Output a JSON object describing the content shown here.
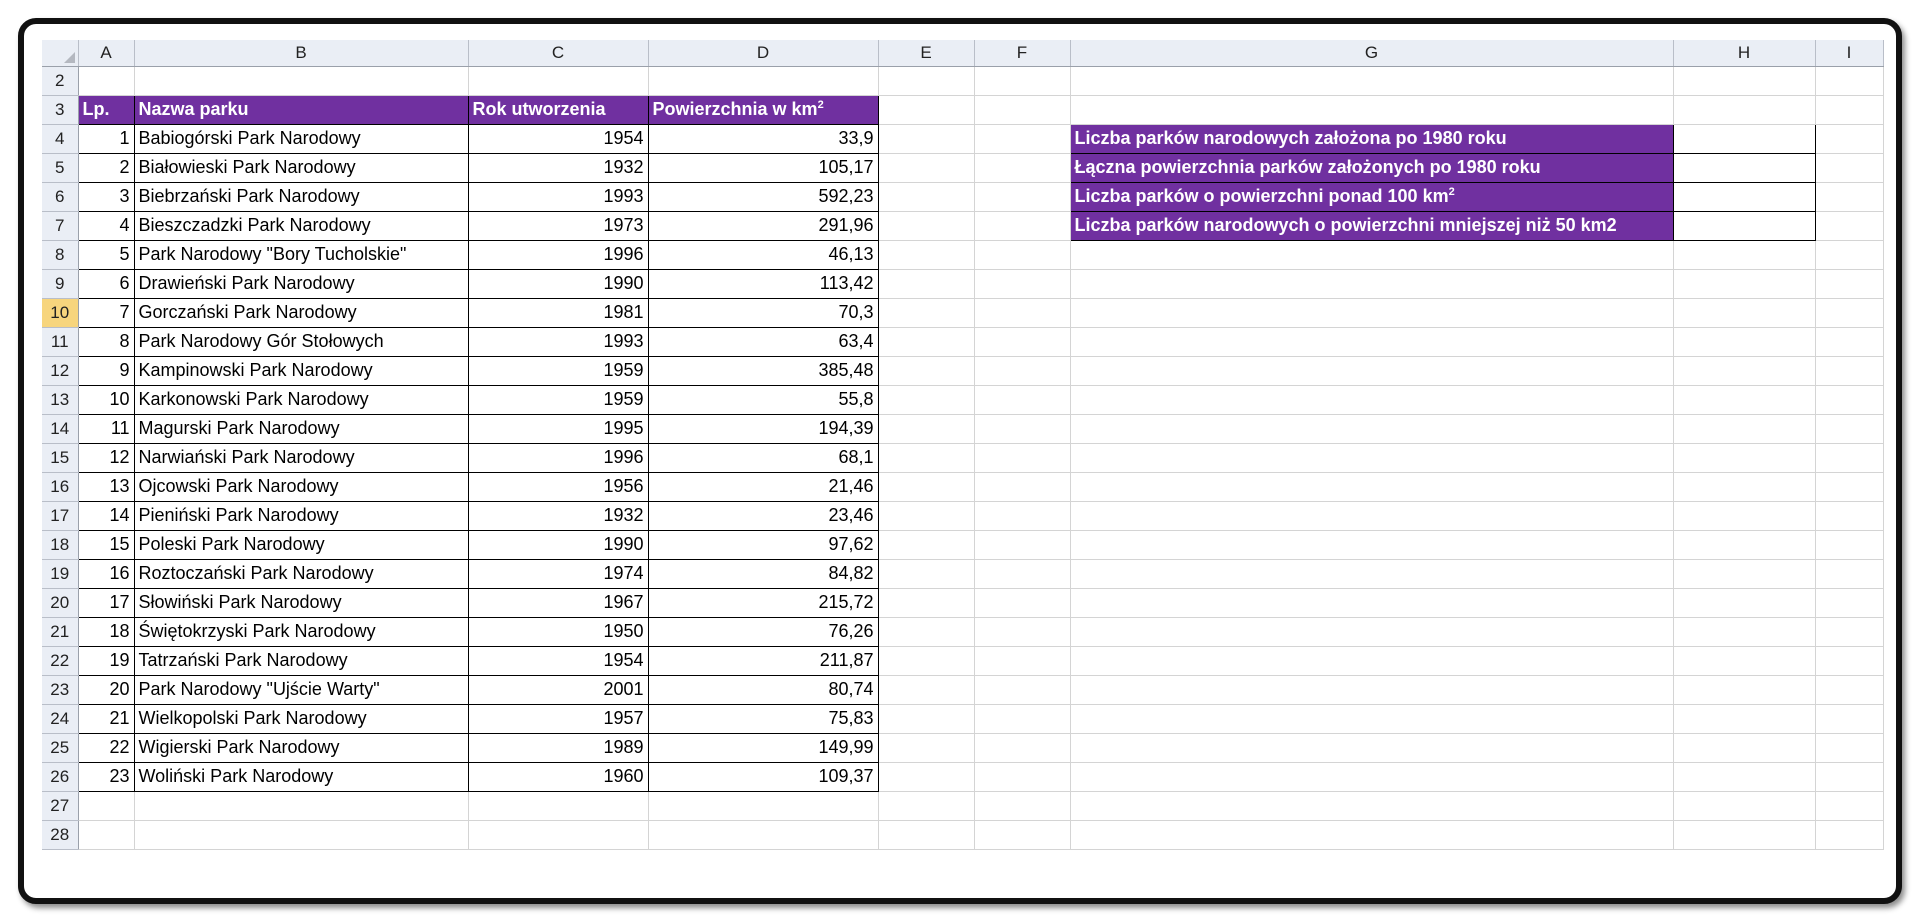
{
  "columns": [
    "A",
    "B",
    "C",
    "D",
    "E",
    "F",
    "G",
    "H",
    "I"
  ],
  "active_row": "10",
  "header_row": {
    "row": "3",
    "lp": "Lp.",
    "name": "Nazwa parku",
    "year": "Rok utworzenia",
    "area": "Powierzchnia w km",
    "area_sup": "2"
  },
  "rows": [
    {
      "row": "4",
      "lp": "1",
      "name": "Babiogórski Park Narodowy",
      "year": "1954",
      "area": "33,9"
    },
    {
      "row": "5",
      "lp": "2",
      "name": "Białowieski Park Narodowy",
      "year": "1932",
      "area": "105,17"
    },
    {
      "row": "6",
      "lp": "3",
      "name": "Biebrzański Park Narodowy",
      "year": "1993",
      "area": "592,23"
    },
    {
      "row": "7",
      "lp": "4",
      "name": "Bieszczadzki Park Narodowy",
      "year": "1973",
      "area": "291,96"
    },
    {
      "row": "8",
      "lp": "5",
      "name": "Park Narodowy \"Bory Tucholskie\"",
      "year": "1996",
      "area": "46,13"
    },
    {
      "row": "9",
      "lp": "6",
      "name": "Drawieński Park Narodowy",
      "year": "1990",
      "area": "113,42"
    },
    {
      "row": "10",
      "lp": "7",
      "name": "Gorczański Park Narodowy",
      "year": "1981",
      "area": "70,3"
    },
    {
      "row": "11",
      "lp": "8",
      "name": "Park Narodowy Gór Stołowych",
      "year": "1993",
      "area": "63,4"
    },
    {
      "row": "12",
      "lp": "9",
      "name": "Kampinowski Park Narodowy",
      "year": "1959",
      "area": "385,48"
    },
    {
      "row": "13",
      "lp": "10",
      "name": "Karkonowski Park Narodowy",
      "year": "1959",
      "area": "55,8"
    },
    {
      "row": "14",
      "lp": "11",
      "name": "Magurski Park Narodowy",
      "year": "1995",
      "area": "194,39"
    },
    {
      "row": "15",
      "lp": "12",
      "name": "Narwiański Park Narodowy",
      "year": "1996",
      "area": "68,1"
    },
    {
      "row": "16",
      "lp": "13",
      "name": "Ojcowski Park Narodowy",
      "year": "1956",
      "area": "21,46"
    },
    {
      "row": "17",
      "lp": "14",
      "name": "Pieniński Park Narodowy",
      "year": "1932",
      "area": "23,46"
    },
    {
      "row": "18",
      "lp": "15",
      "name": "Poleski Park Narodowy",
      "year": "1990",
      "area": "97,62"
    },
    {
      "row": "19",
      "lp": "16",
      "name": "Roztoczański Park Narodowy",
      "year": "1974",
      "area": "84,82"
    },
    {
      "row": "20",
      "lp": "17",
      "name": "Słowiński Park Narodowy",
      "year": "1967",
      "area": "215,72"
    },
    {
      "row": "21",
      "lp": "18",
      "name": "Świętokrzyski Park Narodowy",
      "year": "1950",
      "area": "76,26"
    },
    {
      "row": "22",
      "lp": "19",
      "name": "Tatrzański Park Narodowy",
      "year": "1954",
      "area": "211,87"
    },
    {
      "row": "23",
      "lp": "20",
      "name": "Park Narodowy \"Ujście Warty\"",
      "year": "2001",
      "area": "80,74"
    },
    {
      "row": "24",
      "lp": "21",
      "name": "Wielkopolski Park Narodowy",
      "year": "1957",
      "area": "75,83"
    },
    {
      "row": "25",
      "lp": "22",
      "name": "Wigierski Park Narodowy",
      "year": "1989",
      "area": "149,99"
    },
    {
      "row": "26",
      "lp": "23",
      "name": "Woliński Park Narodowy",
      "year": "1960",
      "area": "109,37"
    }
  ],
  "empty_rows": [
    "2",
    "27",
    "28"
  ],
  "summary": [
    {
      "label": "Liczba parków narodowych założona po 1980 roku",
      "sup": ""
    },
    {
      "label": "Łączna powierzchnia parków założonych po 1980 roku",
      "sup": ""
    },
    {
      "label": "Liczba parków o powierzchni ponad 100 km",
      "sup": "2"
    },
    {
      "label": "Liczba parków narodowych o powierzchni mniejszej niż 50 km2",
      "sup": ""
    }
  ],
  "colors": {
    "header_fill": "#7030a0",
    "header_text": "#ffffff",
    "active_row_header": "#f7d57d",
    "sheet_header_bg": "#eaeef5"
  }
}
